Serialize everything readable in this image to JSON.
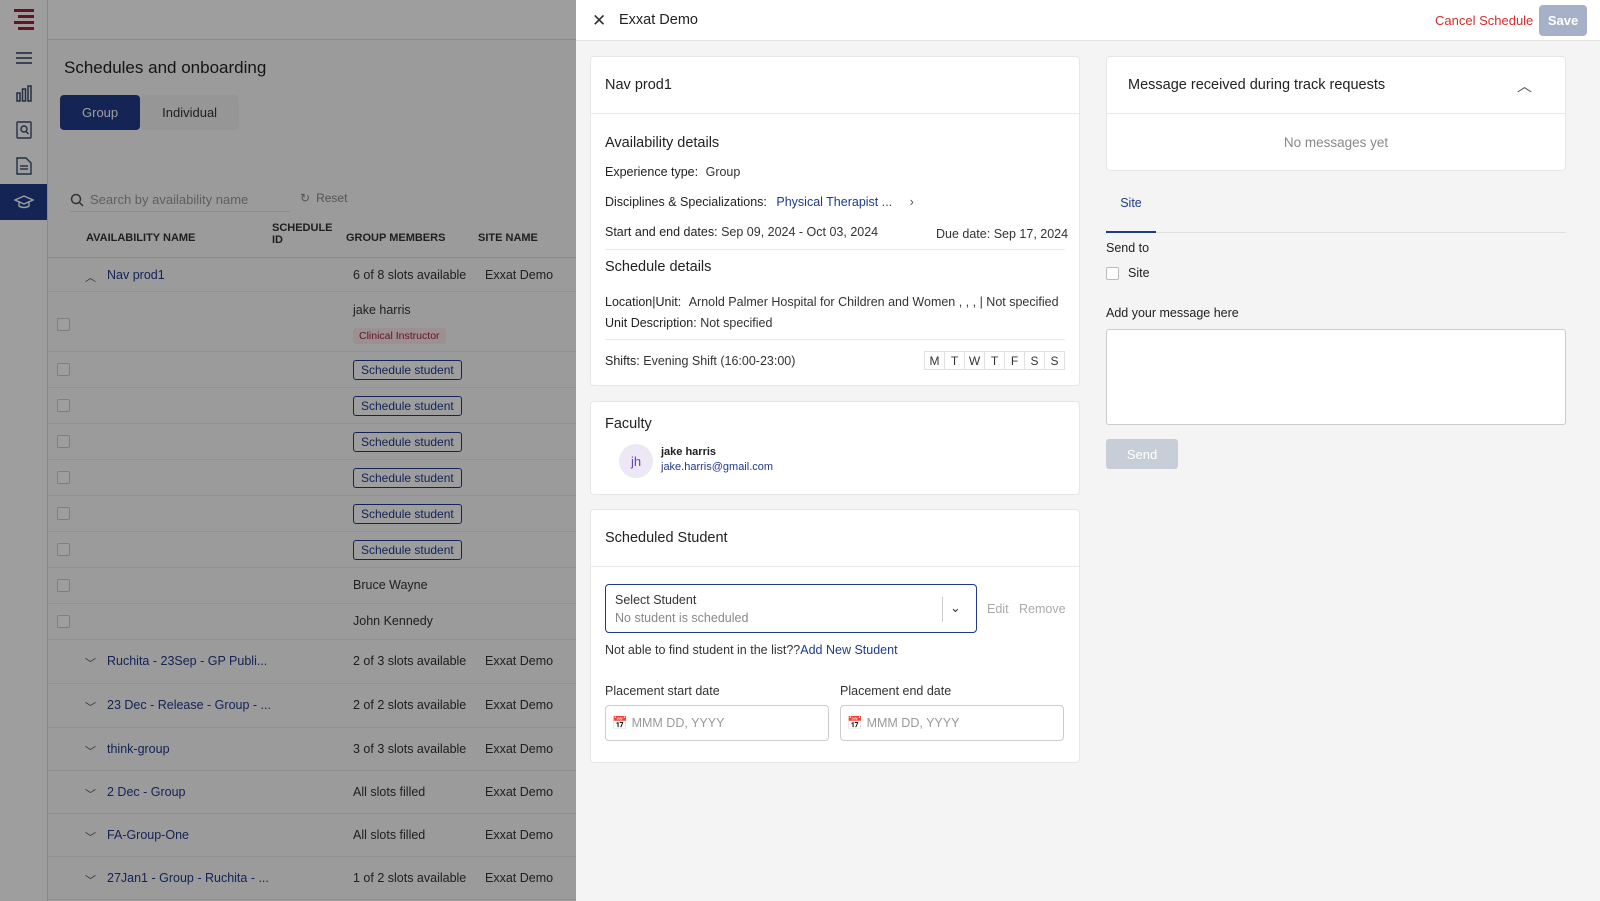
{
  "page": {
    "title": "Schedules and onboarding",
    "tabs": [
      "Group",
      "Individual"
    ],
    "search_placeholder": "Search by availability name",
    "reset_label": "Reset",
    "columns": [
      "AVAILABILITY NAME",
      "SCHEDULE ID",
      "GROUP MEMBERS",
      "SITE NAME"
    ],
    "nav_row": {
      "name": "Nav prod1",
      "members": "6 of 8 slots available",
      "site": "Exxat Demo"
    },
    "member_name": "jake harris",
    "member_badge": "Clinical Instructor",
    "schedule_student_label": "Schedule student",
    "students": [
      "Bruce Wayne",
      "John Kennedy"
    ],
    "groups": [
      {
        "name": "Ruchita - 23Sep - GP Publi...",
        "members": "2 of 3 slots available",
        "site": "Exxat Demo"
      },
      {
        "name": "23 Dec - Release - Group - ...",
        "members": "2 of 2 slots available",
        "site": "Exxat Demo"
      },
      {
        "name": "think-group",
        "members": "3 of 3 slots available",
        "site": "Exxat Demo"
      },
      {
        "name": "2 Dec - Group",
        "members": "All slots filled",
        "site": "Exxat Demo"
      },
      {
        "name": "FA-Group-One",
        "members": "All slots filled",
        "site": "Exxat Demo"
      },
      {
        "name": "27Jan1 - Group - Ruchita - ...",
        "members": "1 of 2 slots available",
        "site": "Exxat Demo"
      }
    ]
  },
  "drawer": {
    "title": "Exxat Demo",
    "cancel_label": "Cancel Schedule",
    "save_label": "Save",
    "availability": {
      "name": "Nav prod1",
      "section_title": "Availability details",
      "experience_label": "Experience type:",
      "experience_value": "Group",
      "disciplines_label": "Disciplines & Specializations:",
      "disciplines_value": "Physical Therapist ...",
      "dates_label": "Start and end dates:",
      "dates_value": "Sep 09, 2024 - Oct 03, 2024",
      "due_label": "Due date:",
      "due_value": "Sep 17, 2024",
      "schedule_title": "Schedule details",
      "location_label": "Location|Unit:",
      "location_value": "Arnold Palmer Hospital for Children and Women , , , | Not specified",
      "unit_label": "Unit Description:",
      "unit_value": "Not specified",
      "shifts_label": "Shifts:",
      "shifts_value": "Evening Shift (16:00-23:00)",
      "days": [
        "M",
        "T",
        "W",
        "T",
        "F",
        "S",
        "S"
      ]
    },
    "faculty": {
      "title": "Faculty",
      "initials": "jh",
      "name": "jake harris",
      "email": "jake.harris@gmail.com"
    },
    "scheduled": {
      "title": "Scheduled Student",
      "select_label": "Select Student",
      "select_value": "No student is scheduled",
      "edit_label": "Edit",
      "remove_label": "Remove",
      "not_found": "Not able to find student in the list??",
      "add_new": "Add New Student",
      "start_label": "Placement start date",
      "end_label": "Placement end date",
      "date_placeholder": "MMM DD, YYYY"
    },
    "messages": {
      "title": "Message received during track requests",
      "empty": "No messages yet",
      "tab": "Site",
      "send_to": "Send to",
      "site_option": "Site",
      "add_label": "Add your message here",
      "send_label": "Send"
    },
    "colors": {
      "primary": "#1f3a8a",
      "danger": "#d32f2f"
    }
  }
}
